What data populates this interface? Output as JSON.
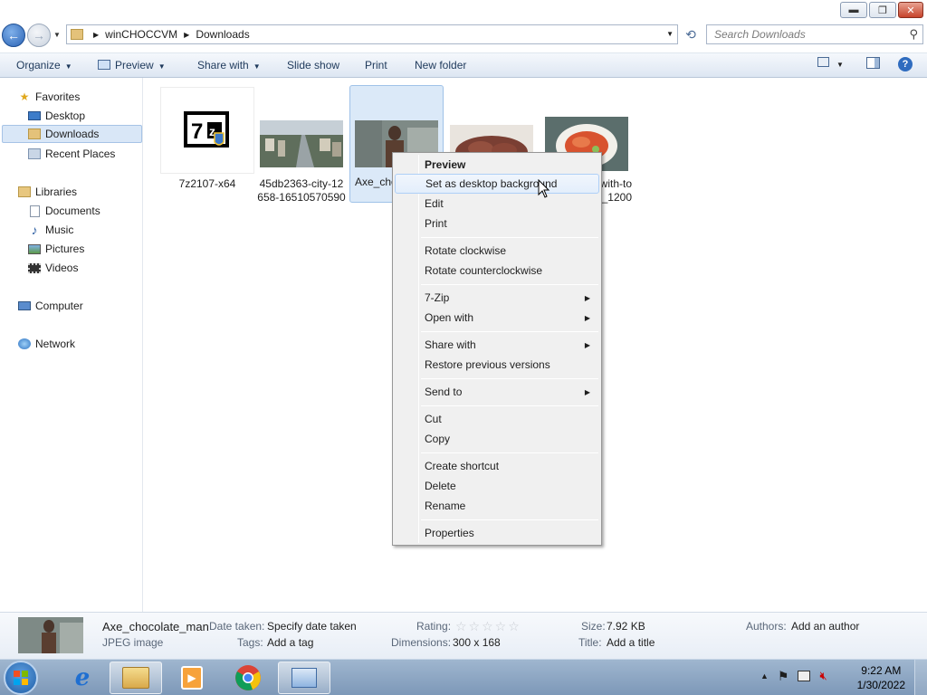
{
  "window": {
    "minimize": "▬",
    "maximize": "❐",
    "close": "✕"
  },
  "address": {
    "crumbs": [
      "winCHOCCVM",
      "Downloads"
    ],
    "search_placeholder": "Search Downloads"
  },
  "toolbar": {
    "organize": "Organize",
    "preview": "Preview",
    "share_with": "Share with",
    "slide_show": "Slide show",
    "print": "Print",
    "new_folder": "New folder"
  },
  "nav": {
    "favorites": "Favorites",
    "desktop": "Desktop",
    "downloads": "Downloads",
    "recent_places": "Recent Places",
    "libraries": "Libraries",
    "documents": "Documents",
    "music": "Music",
    "pictures": "Pictures",
    "videos": "Videos",
    "computer": "Computer",
    "network": "Network"
  },
  "files": [
    {
      "line1": "7z2107-x64",
      "line2": ""
    },
    {
      "line1": "45db2363-city-12",
      "line2": "658-16510570590"
    },
    {
      "line1": "Axe_cho",
      "line2": ""
    },
    {
      "line1": "",
      "line2": ""
    },
    {
      "line1": "with-to",
      "line2": "_1200"
    }
  ],
  "context_menu": {
    "items": [
      {
        "label": "Preview",
        "bold": true
      },
      {
        "label": "Set as desktop background",
        "hover": true
      },
      {
        "label": "Edit"
      },
      {
        "label": "Print"
      },
      {
        "label": "Rotate clockwise"
      },
      {
        "label": "Rotate counterclockwise"
      },
      {
        "label": "7-Zip",
        "submenu": true
      },
      {
        "label": "Open with",
        "submenu": true
      },
      {
        "label": "Share with",
        "submenu": true
      },
      {
        "label": "Restore previous versions"
      },
      {
        "label": "Send to",
        "submenu": true
      },
      {
        "label": "Cut"
      },
      {
        "label": "Copy"
      },
      {
        "label": "Create shortcut"
      },
      {
        "label": "Delete"
      },
      {
        "label": "Rename"
      },
      {
        "label": "Properties"
      }
    ]
  },
  "details": {
    "name": "Axe_chocolate_man",
    "type": "JPEG image",
    "date_taken_label": "Date taken:",
    "date_taken_value": "Specify date taken",
    "tags_label": "Tags:",
    "tags_value": "Add a tag",
    "rating_label": "Rating:",
    "rating_stars": "☆☆☆☆☆",
    "dimensions_label": "Dimensions:",
    "dimensions_value": "300 x 168",
    "size_label": "Size:",
    "size_value": "7.92 KB",
    "title_label": "Title:",
    "title_value": "Add a title",
    "authors_label": "Authors:",
    "authors_value": "Add an author"
  },
  "taskbar": {
    "time": "9:22 AM",
    "date": "1/30/2022"
  }
}
